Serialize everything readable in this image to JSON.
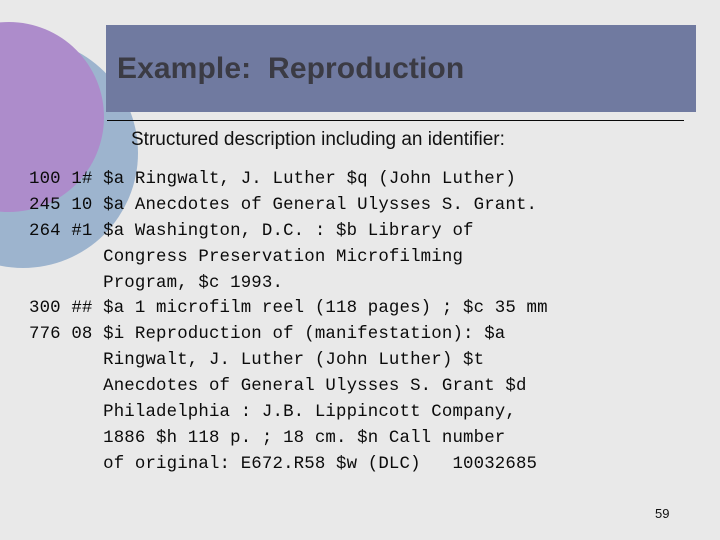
{
  "slide": {
    "page_number": "59",
    "background_color": "#e9e9e9"
  },
  "header": {
    "title": "Example:  Reproduction",
    "banner_color": "#707aa0",
    "title_color": "#3b3b44"
  },
  "subtitle": {
    "text": "Structured description including an identifier:"
  },
  "decor": {
    "purple_circle_color": "#ad8ccb",
    "blue_circle_color": "#9db4ce"
  },
  "record": {
    "lines": [
      "100 1# $a Ringwalt, J. Luther $q (John Luther)",
      "245 10 $a Anecdotes of General Ulysses S. Grant.",
      "264 #1 $a Washington, D.C. : $b Library of",
      "       Congress Preservation Microfilming",
      "       Program, $c 1993.",
      "300 ## $a 1 microfilm reel (118 pages) ; $c 35 mm",
      "776 08 $i Reproduction of (manifestation): $a",
      "       Ringwalt, J. Luther (John Luther) $t",
      "       Anecdotes of General Ulysses S. Grant $d",
      "       Philadelphia : J.B. Lippincott Company,",
      "       1886 $h 118 p. ; 18 cm. $n Call number",
      "       of original: E672.R58 $w (DLC)   10032685"
    ]
  }
}
